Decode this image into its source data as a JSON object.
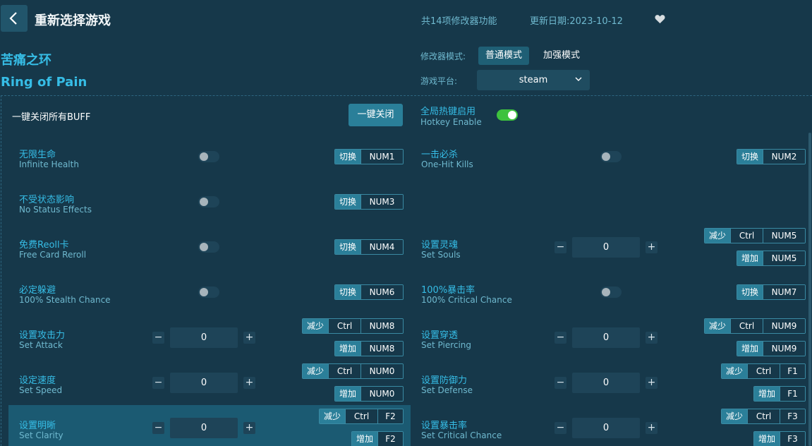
{
  "header": {
    "title": "重新选择游戏",
    "feature_count": "共14项修改器功能",
    "update_date": "更新日期:2023-10-12"
  },
  "game": {
    "name_cn": "苦痛之环",
    "name_en": "Ring of Pain"
  },
  "mode": {
    "label": "修改器模式:",
    "normal": "普通模式",
    "enhanced": "加强模式",
    "active": "普通模式"
  },
  "platform": {
    "label": "游戏平台:",
    "selected": "steam"
  },
  "controls": {
    "close_all_label": "一键关闭所有BUFF",
    "close_all_button": "一键关闭",
    "hotkey_cn": "全局热键启用",
    "hotkey_en": "Hotkey Enable",
    "hotkey_enabled": true
  },
  "labels": {
    "toggle": "切换",
    "decrease": "减少",
    "increase": "增加",
    "ctrl": "Ctrl"
  },
  "cheats_left": [
    {
      "cn": "无限生命",
      "en": "Infinite Health",
      "type": "toggle",
      "key": "NUM1"
    },
    {
      "cn": "不受状态影响",
      "en": "No Status Effects",
      "type": "toggle",
      "key": "NUM3"
    },
    {
      "cn": "免费Reoll卡",
      "en": "Free Card Reroll",
      "type": "toggle",
      "key": "NUM4"
    },
    {
      "cn": "必定躲避",
      "en": "100% Stealth Chance",
      "type": "toggle",
      "key": "NUM6"
    },
    {
      "cn": "设置攻击力",
      "en": "Set Attack",
      "type": "number",
      "value": "0",
      "dec_key": "NUM8",
      "inc_key": "NUM8"
    },
    {
      "cn": "设定速度",
      "en": "Set Speed",
      "type": "number",
      "value": "0",
      "dec_key": "NUM0",
      "inc_key": "NUM0"
    },
    {
      "cn": "设置明晰",
      "en": "Set Clarity",
      "type": "number",
      "value": "0",
      "dec_key": "F2",
      "inc_key": "F2"
    }
  ],
  "cheats_right": [
    {
      "cn": "一击必杀",
      "en": "One-Hit Kills",
      "type": "toggle",
      "key": "NUM2"
    },
    {
      "cn": "设置灵魂",
      "en": "Set Souls",
      "type": "number",
      "value": "0",
      "dec_key": "NUM5",
      "inc_key": "NUM5"
    },
    {
      "cn": "100%暴击率",
      "en": "100% Critical Chance",
      "type": "toggle",
      "key": "NUM7"
    },
    {
      "cn": "设置穿透",
      "en": "Set Piercing",
      "type": "number",
      "value": "0",
      "dec_key": "NUM9",
      "inc_key": "NUM9"
    },
    {
      "cn": "设置防御力",
      "en": "Set Defense",
      "type": "number",
      "value": "0",
      "dec_key": "F1",
      "inc_key": "F1"
    },
    {
      "cn": "设置暴击率",
      "en": "Set Critical Chance",
      "type": "number",
      "value": "0",
      "dec_key": "F3",
      "inc_key": "F3"
    }
  ],
  "colors": {
    "background": "#16384a",
    "accent": "#36bde6",
    "button": "#2a7f99",
    "toggle_on": "#3ec23e"
  },
  "icons": {
    "back": "chevron-left-icon",
    "favorite": "heart-icon",
    "dropdown": "chevron-down-icon"
  }
}
